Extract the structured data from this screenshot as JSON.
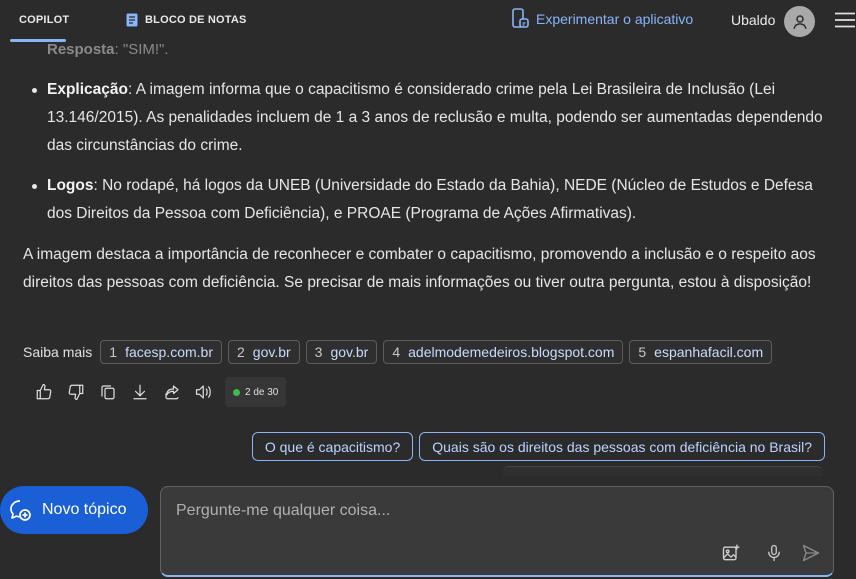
{
  "topbar": {
    "tab_copilot": "COPILOT",
    "tab_notes": "BLOCO DE NOTAS",
    "try_app": "Experimentar o aplicativo",
    "user_name": "Ubaldo"
  },
  "message": {
    "faded_label": "Resposta",
    "faded_rest": ": \"SIM!\".",
    "bullets": [
      {
        "label": "Explicação",
        "text": ": A imagem informa que o capacitismo é considerado crime pela Lei Brasileira de Inclusão (Lei 13.146/2015). As penalidades incluem de 1 a 3 anos de reclusão e multa, podendo ser aumentadas dependendo das circunstâncias do crime."
      },
      {
        "label": "Logos",
        "text": ": No rodapé, há logos da UNEB (Universidade do Estado da Bahia), NEDE (Núcleo de Estudos e Defesa dos Direitos da Pessoa com Deficiência), e PROAE (Programa de Ações Afirmativas)."
      }
    ],
    "paragraph": "A imagem destaca a importância de reconhecer e combater o capacitismo, promovendo a inclusão e o respeito aos direitos das pessoas com deficiência. Se precisar de mais informações ou tiver outra pergunta, estou à disposição!"
  },
  "sources": {
    "label": "Saiba mais",
    "items": [
      {
        "num": "1",
        "domain": "facesp.com.br"
      },
      {
        "num": "2",
        "domain": "gov.br"
      },
      {
        "num": "3",
        "domain": "gov.br"
      },
      {
        "num": "4",
        "domain": "adelmodemedeiros.blogspot.com"
      },
      {
        "num": "5",
        "domain": "espanhafacil.com"
      }
    ]
  },
  "counter": {
    "text": "2 de 30",
    "status_color": "#3fb950"
  },
  "suggestions": [
    "O que é capacitismo?",
    "Quais são os direitos das pessoas com deficiência no Brasil?"
  ],
  "composer": {
    "new_topic": "Novo tópico",
    "placeholder": "Pergunte-me qualquer coisa..."
  },
  "icons": {
    "like": "thumbs-up-icon",
    "dislike": "thumbs-down-icon",
    "copy": "copy-icon",
    "download": "download-icon",
    "share": "share-icon",
    "read": "speaker-icon",
    "image": "add-image-icon",
    "mic": "microphone-icon",
    "send": "send-icon"
  },
  "colors": {
    "background": "#2b2b2b",
    "accent": "#8ab4f8",
    "new_topic_button": "#1a5fd6"
  }
}
